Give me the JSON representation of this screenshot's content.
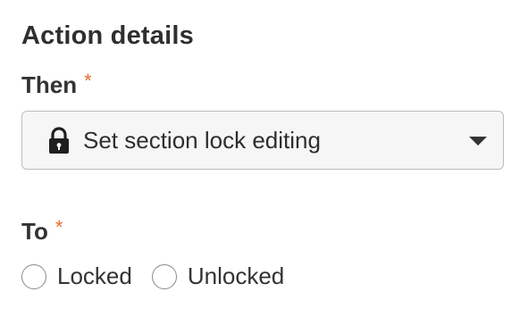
{
  "section": {
    "title": "Action details"
  },
  "then_field": {
    "label": "Then",
    "required_mark": "*",
    "selected_value": "Set section lock editing",
    "icon": "lock-icon"
  },
  "to_field": {
    "label": "To",
    "required_mark": "*",
    "options": [
      {
        "label": "Locked",
        "selected": false
      },
      {
        "label": "Unlocked",
        "selected": false
      }
    ]
  },
  "colors": {
    "required": "#e0722f",
    "select_background": "#f6f6f6",
    "border": "#bdbdbd"
  }
}
